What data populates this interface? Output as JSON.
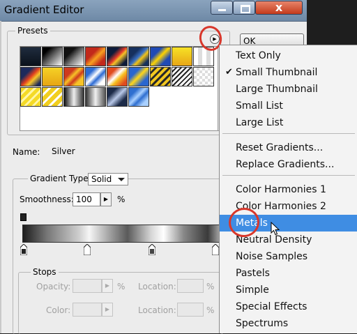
{
  "window": {
    "title": "Gradient Editor",
    "close_glyph": "x"
  },
  "presets": {
    "legend": "Presets"
  },
  "buttons": {
    "ok": "OK"
  },
  "name": {
    "label": "Name:",
    "value": "Silver"
  },
  "gradient_type": {
    "label": "Gradient Type:",
    "value": "Solid"
  },
  "smoothness": {
    "label": "Smoothness:",
    "value": "100",
    "unit": "%"
  },
  "stops": {
    "legend": "Stops",
    "opacity_label": "Opacity:",
    "opacity_unit": "%",
    "location_label": "Location:",
    "location_unit": "%",
    "color_label": "Color:"
  },
  "menu": {
    "group1": [
      "Text Only",
      "Small Thumbnail",
      "Large Thumbnail",
      "Small List",
      "Large List"
    ],
    "checked": "Small Thumbnail",
    "group2": [
      "Reset Gradients...",
      "Replace Gradients..."
    ],
    "group3": [
      "Color Harmonies 1",
      "Color Harmonies 2",
      "Metals",
      "Neutral Density",
      "Noise Samples",
      "Pastels",
      "Simple",
      "Special Effects",
      "Spectrums"
    ],
    "highlighted": "Metals"
  },
  "colors": {
    "menu_highlight": "#3f8de3",
    "annotation_circle": "#d8372b",
    "title_bar": "#7d97b3"
  }
}
